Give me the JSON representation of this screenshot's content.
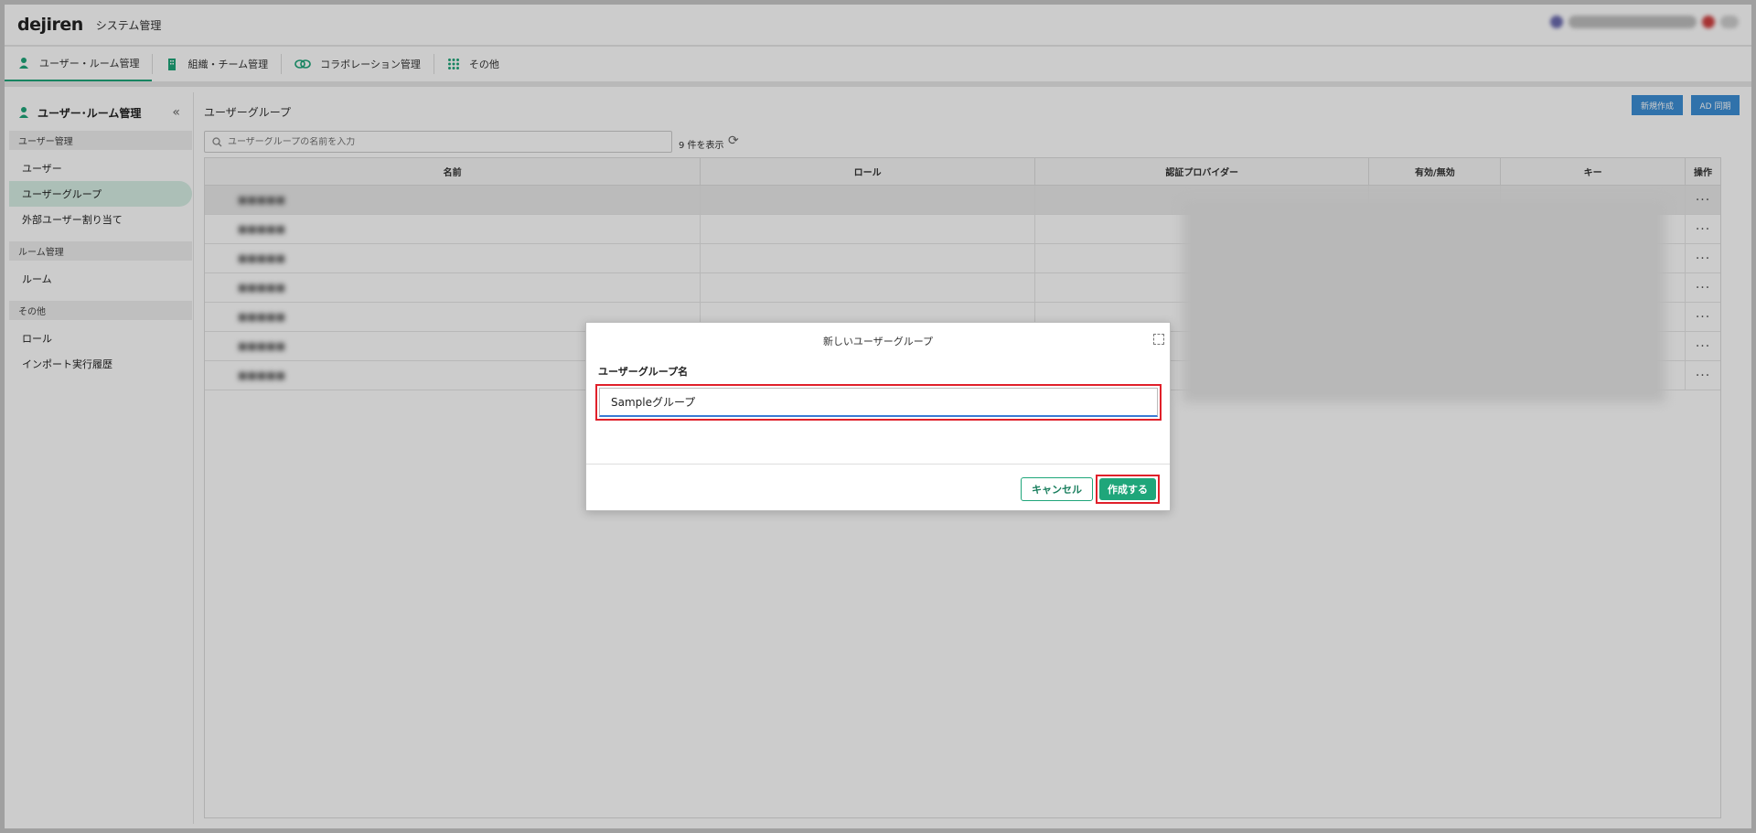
{
  "header": {
    "logo": "dejiren",
    "title": "システム管理"
  },
  "tabs": [
    {
      "label": "ユーザー・ルーム管理",
      "icon": "person-icon"
    },
    {
      "label": "組織・チーム管理",
      "icon": "building-icon"
    },
    {
      "label": "コラボレーション管理",
      "icon": "link-icon"
    },
    {
      "label": "その他",
      "icon": "grid-icon"
    }
  ],
  "sidebar": {
    "title": "ユーザー･ルーム管理",
    "sections": [
      {
        "label": "ユーザー管理",
        "items": [
          "ユーザー",
          "ユーザーグループ",
          "外部ユーザー割り当て"
        ]
      },
      {
        "label": "ルーム管理",
        "items": [
          "ルーム"
        ]
      },
      {
        "label": "その他",
        "items": [
          "ロール",
          "インポート実行履歴"
        ]
      }
    ]
  },
  "main": {
    "title": "ユーザーグループ",
    "buttons": {
      "new": "新規作成",
      "ad_sync": "AD 同期"
    },
    "search_placeholder": "ユーザーグループの名前を入力",
    "count": "9 件を表示",
    "columns": [
      "名前",
      "ロール",
      "認証プロバイダー",
      "有効/無効",
      "キー",
      "操作"
    ]
  },
  "modal": {
    "title": "新しいユーザーグループ",
    "field_label": "ユーザーグループ名",
    "field_value": "Sampleグループ",
    "cancel": "キャンセル",
    "create": "作成する"
  },
  "colors": {
    "accent": "#1fa67a",
    "highlight": "#e0202a",
    "blue": "#3d8fd6"
  }
}
